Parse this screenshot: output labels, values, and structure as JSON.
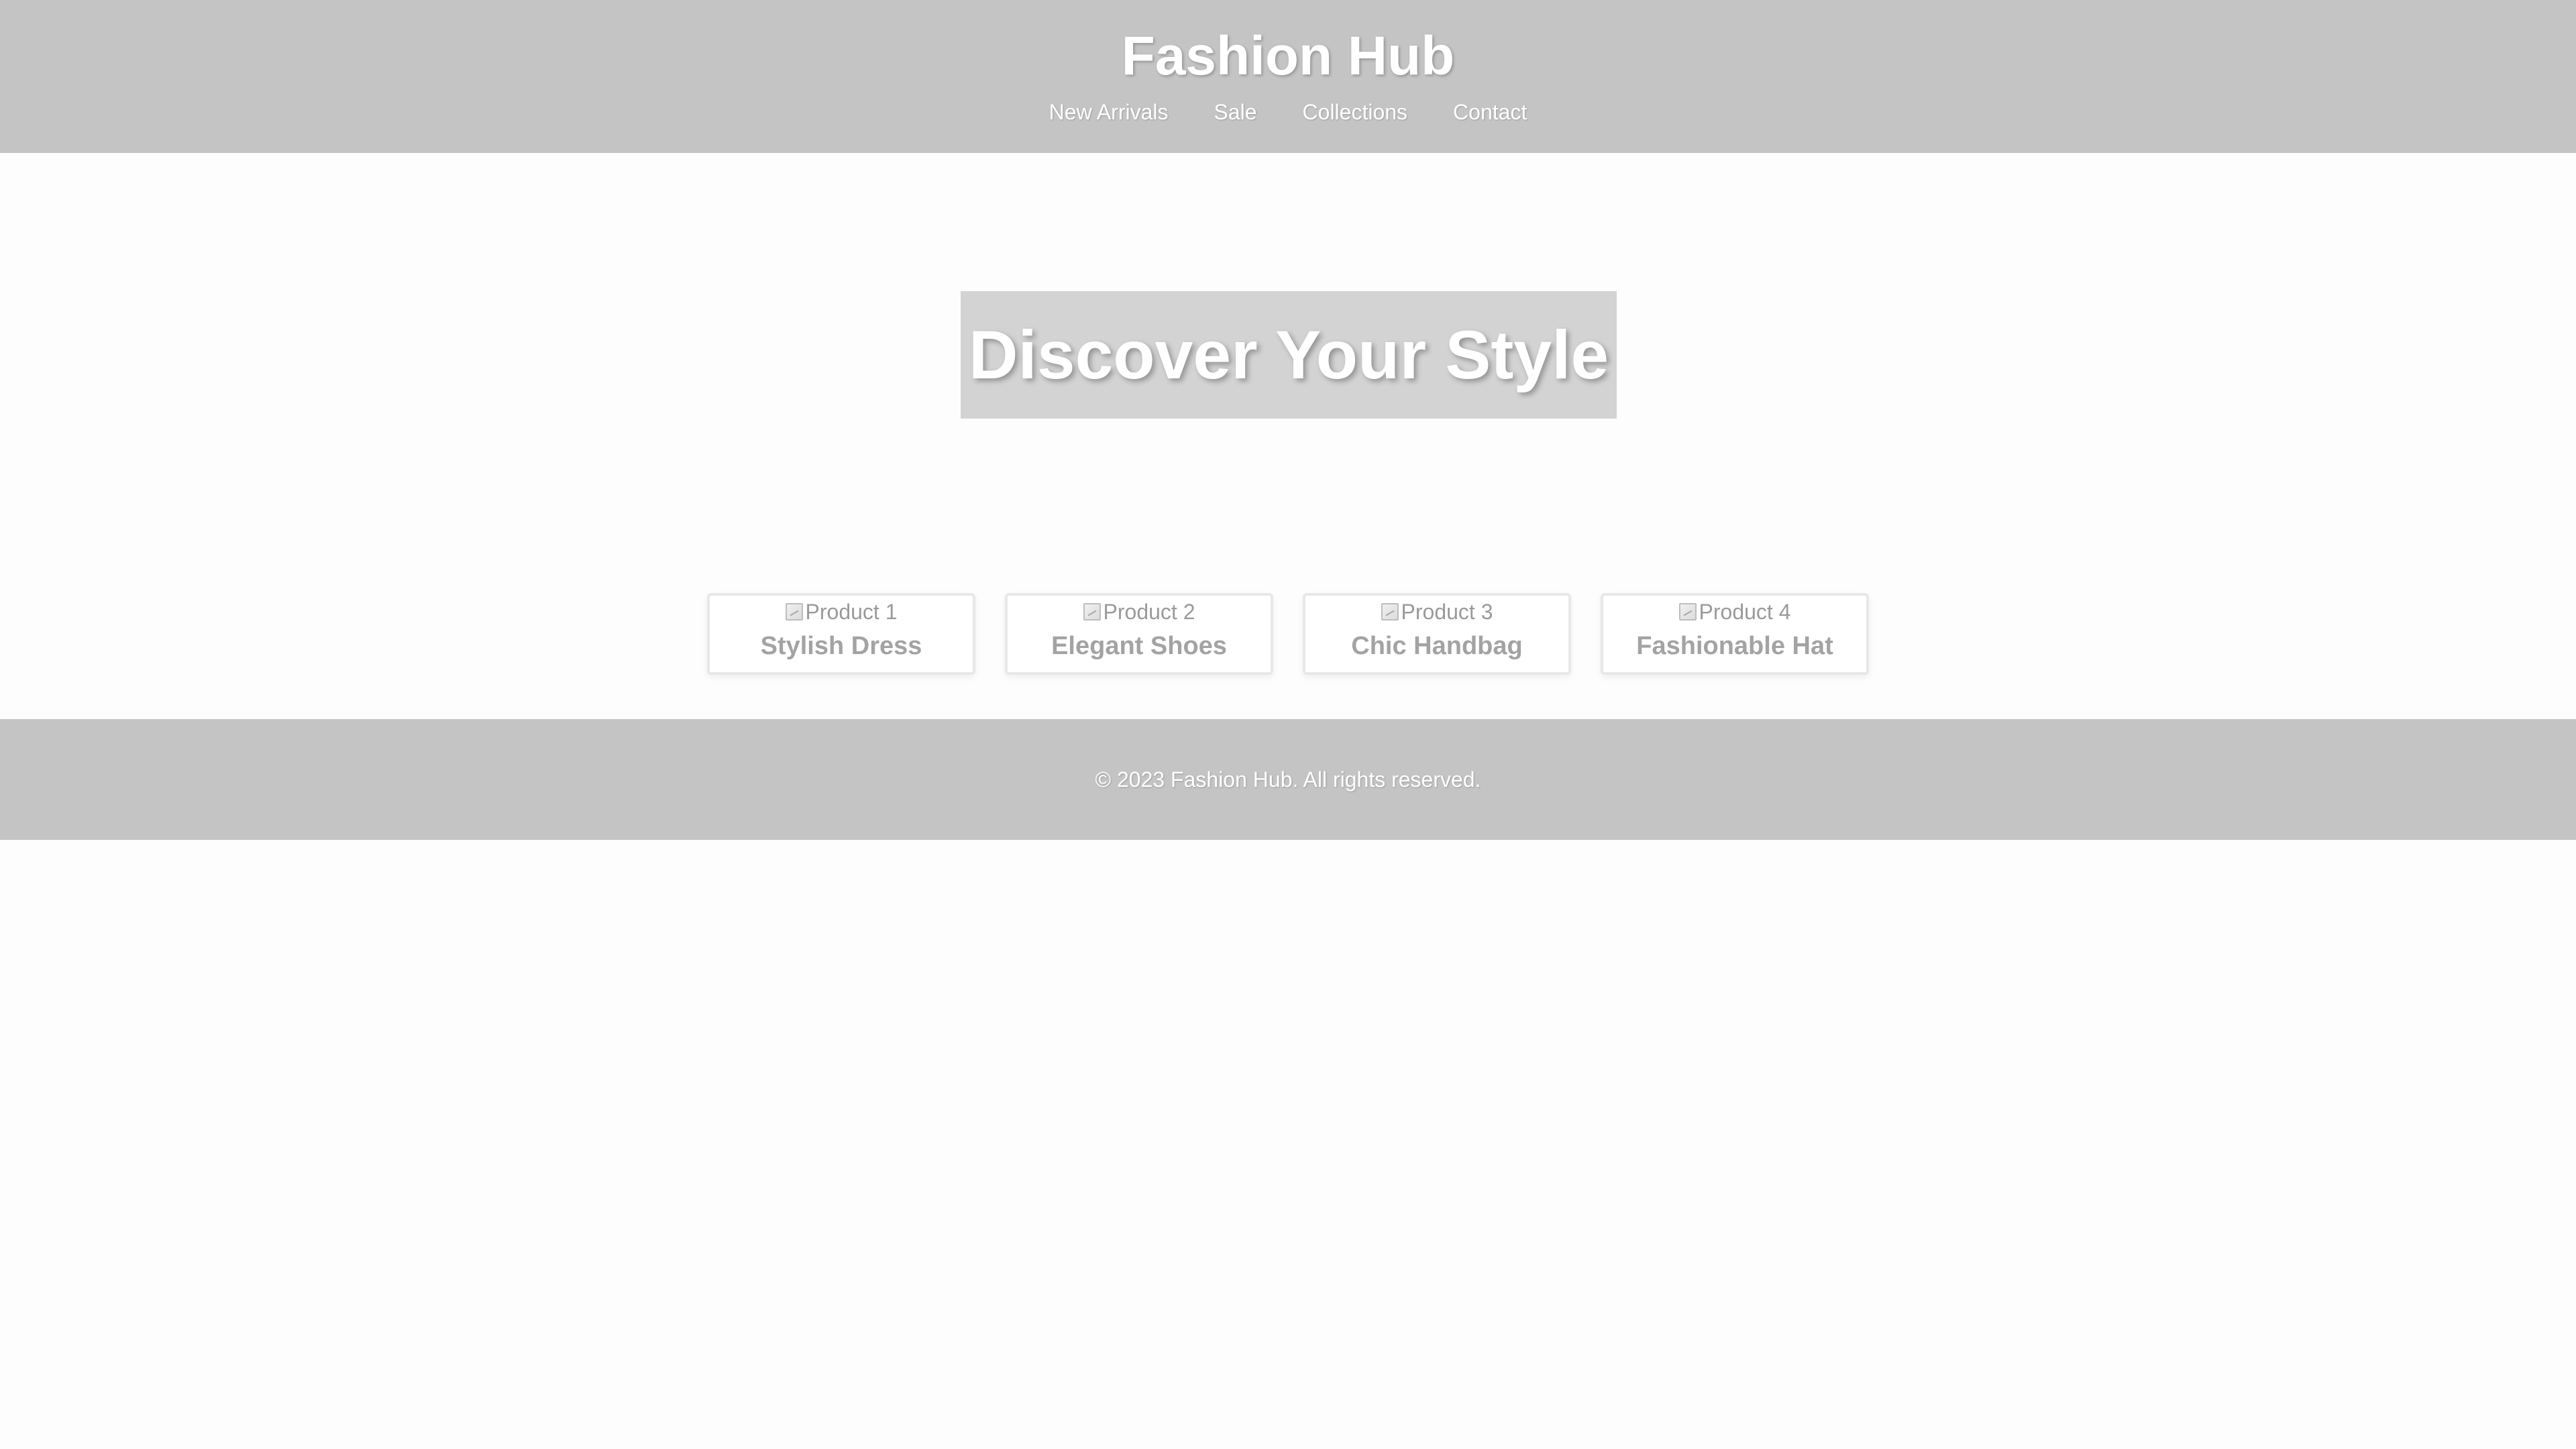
{
  "header": {
    "title": "Fashion Hub",
    "nav": [
      {
        "label": "New Arrivals"
      },
      {
        "label": "Sale"
      },
      {
        "label": "Collections"
      },
      {
        "label": "Contact"
      }
    ]
  },
  "hero": {
    "title": "Discover Your Style"
  },
  "products": [
    {
      "image_alt": "Product 1",
      "name": "Stylish Dress"
    },
    {
      "image_alt": "Product 2",
      "name": "Elegant Shoes"
    },
    {
      "image_alt": "Product 3",
      "name": "Chic Handbag"
    },
    {
      "image_alt": "Product 4",
      "name": "Fashionable Hat"
    }
  ],
  "footer": {
    "copyright": "© 2023 Fashion Hub. All rights reserved."
  },
  "colors": {
    "header_bg": "#c4c4c4",
    "hero_box_bg": "#d3d3d3",
    "footer_bg": "#c4c4c4",
    "page_bg": "#fdfdfd",
    "product_name": "#a3a3a3"
  },
  "icons": {
    "product_image": "broken-image-icon"
  }
}
